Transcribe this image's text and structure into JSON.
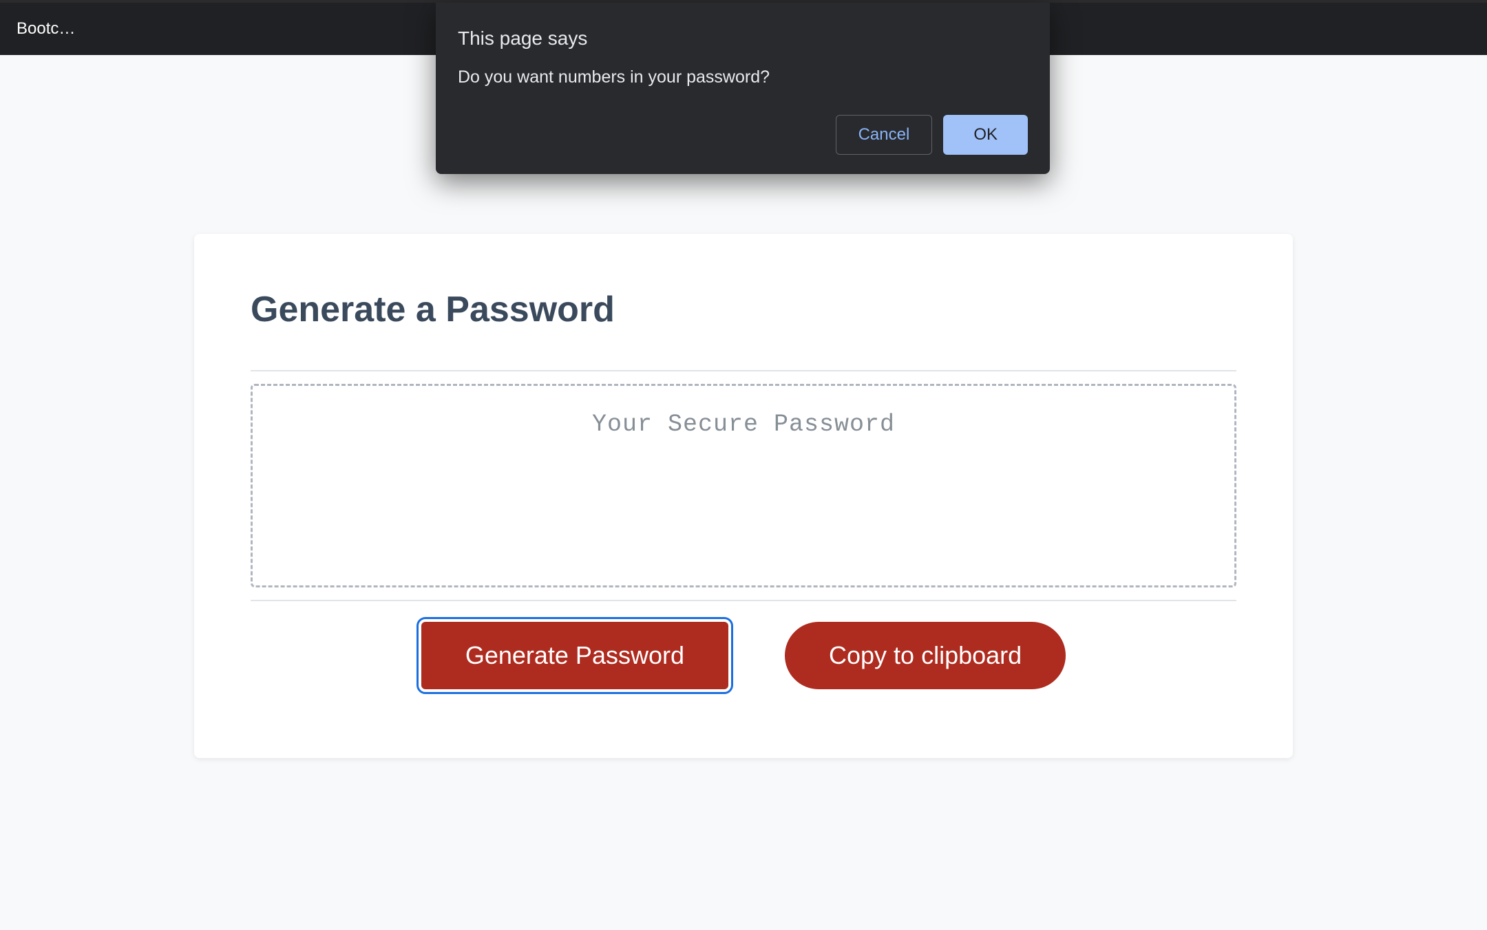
{
  "browser": {
    "tab_label": "Bootc…"
  },
  "dialog": {
    "title": "This page says",
    "message": "Do you want numbers in your password?",
    "cancel_label": "Cancel",
    "ok_label": "OK"
  },
  "card": {
    "title": "Generate a Password",
    "password_placeholder": "Your Secure Password",
    "generate_label": "Generate Password",
    "copy_label": "Copy to clipboard"
  }
}
